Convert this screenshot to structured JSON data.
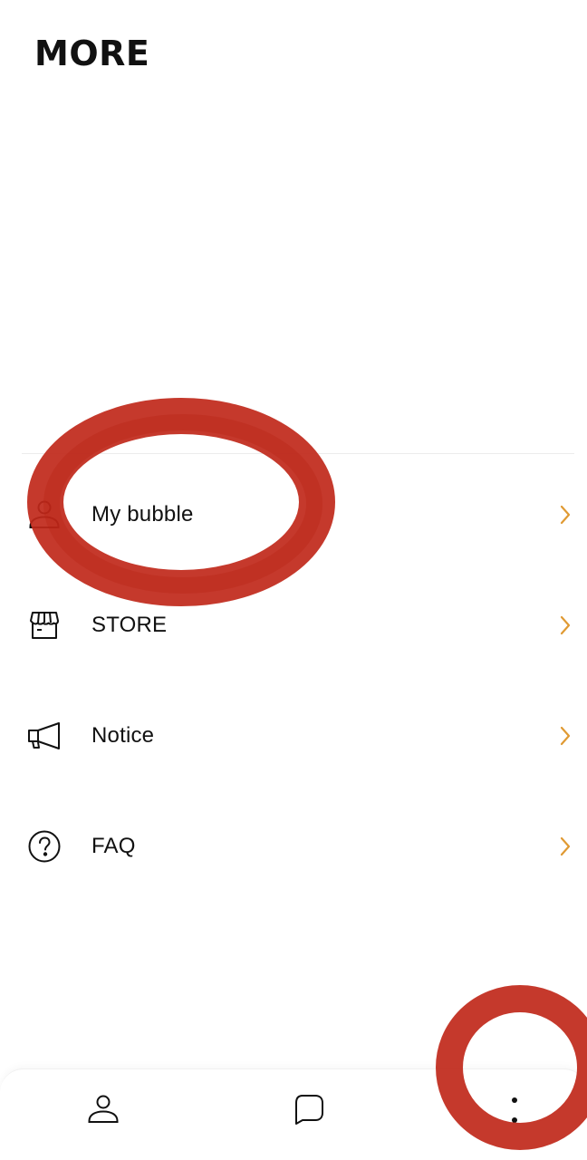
{
  "header": {
    "title": "MORE"
  },
  "menu": {
    "items": [
      {
        "label": "My bubble",
        "icon": "person-icon"
      },
      {
        "label": "STORE",
        "icon": "storefront-icon"
      },
      {
        "label": "Notice",
        "icon": "megaphone-icon"
      },
      {
        "label": "FAQ",
        "icon": "question-circle-icon"
      }
    ]
  },
  "bottom_nav": {
    "items": [
      {
        "icon": "person-icon",
        "selected": false
      },
      {
        "icon": "chat-bubble-icon",
        "selected": false
      },
      {
        "icon": "more-vertical-icon",
        "selected": true
      }
    ]
  },
  "colors": {
    "accent": "#E09A33",
    "text": "#111111",
    "annotation": "#C0281A"
  }
}
